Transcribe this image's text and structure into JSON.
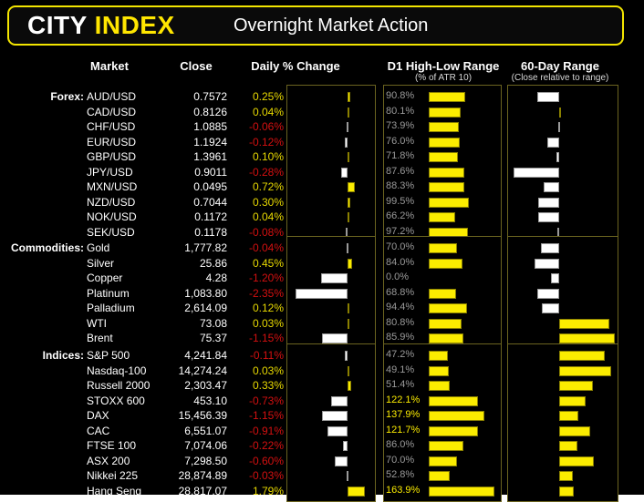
{
  "header": {
    "brand_city": "CITY",
    "brand_index": "INDEX",
    "title": "Overnight Market Action",
    "accent_color": "#ffe600"
  },
  "columns": {
    "market": "Market",
    "close": "Close",
    "daily_change": "Daily % Change",
    "d1_range": "D1 High-Low Range",
    "d1_range_sub": "(% of ATR 10)",
    "sixty_day": "60-Day Range",
    "sixty_day_sub": "(Close relative to range)"
  },
  "section_labels": {
    "forex": "Forex:",
    "commodities": "Commodities:",
    "indices": "Indices:"
  },
  "colors": {
    "positive": "#e8d900",
    "negative": "#d31010",
    "bar_positive": "#fbec00",
    "bar_negative": "#ffffff",
    "panel_border": "#6b6420",
    "background": "#000000"
  },
  "chart_data": {
    "type": "bar",
    "title": "Overnight Market Action",
    "orientation": "horizontal",
    "panels": [
      {
        "name": "Daily % Change",
        "unit": "%",
        "diverging": true
      },
      {
        "name": "D1 High-Low Range",
        "unit": "% of ATR 10",
        "diverging": false
      },
      {
        "name": "60-Day Range",
        "unit": "close relative to range",
        "diverging": true
      }
    ],
    "sections": [
      {
        "name": "Forex",
        "rows": [
          {
            "market": "AUD/USD",
            "close": "0.7572",
            "daily_pct": 0.25,
            "daily_pct_label": "0.25%",
            "d1_pct": 90.8,
            "d1_label": "90.8%",
            "sixty_day": -0.62
          },
          {
            "market": "CAD/USD",
            "close": "0.8126",
            "daily_pct": 0.04,
            "daily_pct_label": "0.04%",
            "d1_pct": 80.1,
            "d1_label": "80.1%",
            "sixty_day": 0.06
          },
          {
            "market": "CHF/USD",
            "close": "1.0885",
            "daily_pct": -0.06,
            "daily_pct_label": "-0.06%",
            "d1_pct": 73.9,
            "d1_label": "73.9%",
            "sixty_day": -0.02
          },
          {
            "market": "EUR/USD",
            "close": "1.1924",
            "daily_pct": -0.12,
            "daily_pct_label": "-0.12%",
            "d1_pct": 76.0,
            "d1_label": "76.0%",
            "sixty_day": -0.34
          },
          {
            "market": "GBP/USD",
            "close": "1.3961",
            "daily_pct": 0.1,
            "daily_pct_label": "0.10%",
            "d1_pct": 71.8,
            "d1_label": "71.8%",
            "sixty_day": -0.06
          },
          {
            "market": "JPY/USD",
            "close": "0.9011",
            "daily_pct": -0.28,
            "daily_pct_label": "-0.28%",
            "d1_pct": 87.6,
            "d1_label": "87.6%",
            "sixty_day": -1.32
          },
          {
            "market": "MXN/USD",
            "close": "0.0495",
            "daily_pct": 0.72,
            "daily_pct_label": "0.72%",
            "d1_pct": 88.3,
            "d1_label": "88.3%",
            "sixty_day": -0.44
          },
          {
            "market": "NZD/USD",
            "close": "0.7044",
            "daily_pct": 0.3,
            "daily_pct_label": "0.30%",
            "d1_pct": 99.5,
            "d1_label": "99.5%",
            "sixty_day": -0.6
          },
          {
            "market": "NOK/USD",
            "close": "0.1172",
            "daily_pct": 0.04,
            "daily_pct_label": "0.04%",
            "d1_pct": 66.2,
            "d1_label": "66.2%",
            "sixty_day": -0.6
          },
          {
            "market": "SEK/USD",
            "close": "0.1178",
            "daily_pct": -0.08,
            "daily_pct_label": "-0.08%",
            "d1_pct": 97.2,
            "d1_label": "97.2%",
            "sixty_day": -0.05
          }
        ]
      },
      {
        "name": "Commodities",
        "rows": [
          {
            "market": "Gold",
            "close": "1,777.82",
            "daily_pct": -0.04,
            "daily_pct_label": "-0.04%",
            "d1_pct": 70.0,
            "d1_label": "70.0%",
            "sixty_day": -0.52
          },
          {
            "market": "Silver",
            "close": "25.86",
            "daily_pct": 0.45,
            "daily_pct_label": "0.45%",
            "d1_pct": 84.0,
            "d1_label": "84.0%",
            "sixty_day": -0.72
          },
          {
            "market": "Copper",
            "close": "4.28",
            "daily_pct": -1.2,
            "daily_pct_label": "-1.20%",
            "d1_pct": 0.0,
            "d1_label": "0.0%",
            "sixty_day": -0.22
          },
          {
            "market": "Platinum",
            "close": "1,083.80",
            "daily_pct": -2.35,
            "daily_pct_label": "-2.35%",
            "d1_pct": 68.8,
            "d1_label": "68.8%",
            "sixty_day": -0.62
          },
          {
            "market": "Palladium",
            "close": "2,614.09",
            "daily_pct": 0.12,
            "daily_pct_label": "0.12%",
            "d1_pct": 94.4,
            "d1_label": "94.4%",
            "sixty_day": -0.5
          },
          {
            "market": "WTI",
            "close": "73.08",
            "daily_pct": 0.03,
            "daily_pct_label": "0.03%",
            "d1_pct": 80.8,
            "d1_label": "80.8%",
            "sixty_day": 1.22
          },
          {
            "market": "Brent",
            "close": "75.37",
            "daily_pct": -1.15,
            "daily_pct_label": "-1.15%",
            "d1_pct": 85.9,
            "d1_label": "85.9%",
            "sixty_day": 1.36
          }
        ]
      },
      {
        "name": "Indices",
        "rows": [
          {
            "market": "S&P 500",
            "close": "4,241.84",
            "daily_pct": -0.11,
            "daily_pct_label": "-0.11%",
            "d1_pct": 47.2,
            "d1_label": "47.2%",
            "sixty_day": 1.12
          },
          {
            "market": "Nasdaq-100",
            "close": "14,274.24",
            "daily_pct": 0.03,
            "daily_pct_label": "0.03%",
            "d1_pct": 49.1,
            "d1_label": "49.1%",
            "sixty_day": 1.28
          },
          {
            "market": "Russell 2000",
            "close": "2,303.47",
            "daily_pct": 0.33,
            "daily_pct_label": "0.33%",
            "d1_pct": 51.4,
            "d1_label": "51.4%",
            "sixty_day": 0.82
          },
          {
            "market": "STOXX 600",
            "close": "453.10",
            "daily_pct": -0.73,
            "daily_pct_label": "-0.73%",
            "d1_pct": 122.1,
            "d1_label": "122.1%",
            "sixty_day": 0.64
          },
          {
            "market": "DAX",
            "close": "15,456.39",
            "daily_pct": -1.15,
            "daily_pct_label": "-1.15%",
            "d1_pct": 137.9,
            "d1_label": "137.9%",
            "sixty_day": 0.48
          },
          {
            "market": "CAC",
            "close": "6,551.07",
            "daily_pct": -0.91,
            "daily_pct_label": "-0.91%",
            "d1_pct": 121.7,
            "d1_label": "121.7%",
            "sixty_day": 0.76
          },
          {
            "market": "FTSE 100",
            "close": "7,074.06",
            "daily_pct": -0.22,
            "daily_pct_label": "-0.22%",
            "d1_pct": 86.0,
            "d1_label": "86.0%",
            "sixty_day": 0.46
          },
          {
            "market": "ASX 200",
            "close": "7,298.50",
            "daily_pct": -0.6,
            "daily_pct_label": "-0.60%",
            "d1_pct": 70.0,
            "d1_label": "70.0%",
            "sixty_day": 0.86
          },
          {
            "market": "Nikkei 225",
            "close": "28,874.89",
            "daily_pct": -0.03,
            "daily_pct_label": "-0.03%",
            "d1_pct": 52.8,
            "d1_label": "52.8%",
            "sixty_day": 0.33
          },
          {
            "market": "Hang Seng",
            "close": "28,817.07",
            "daily_pct": 1.79,
            "daily_pct_label": "1.79%",
            "d1_pct": 163.9,
            "d1_label": "163.9%",
            "sixty_day": 0.36
          }
        ]
      }
    ]
  }
}
